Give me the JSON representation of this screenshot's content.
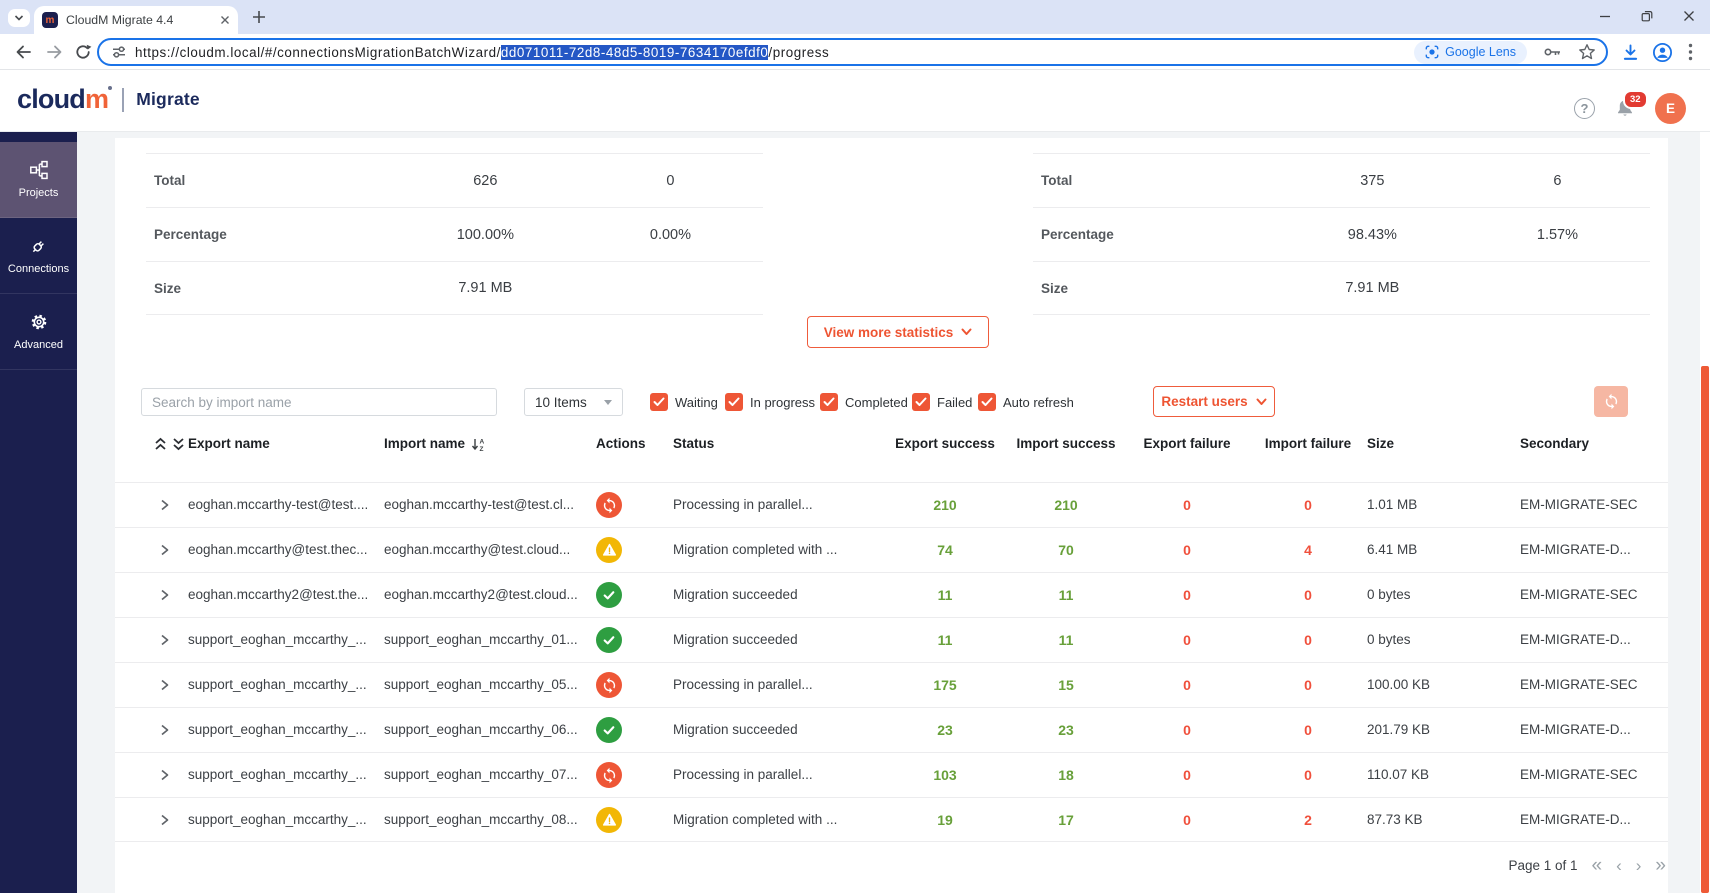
{
  "browser": {
    "tab_title": "CloudM Migrate 4.4",
    "favicon_letter": "m",
    "url_prefix": "https://cloudm.local/#/connectionsMigrationBatchWizard/",
    "url_selected": "dd071011-72d8-48d5-8019-7634170efdf0",
    "url_suffix": "/progress",
    "lens_label": "Google Lens"
  },
  "header": {
    "logo_cloud": "cloud",
    "logo_m": "m",
    "product": "Migrate",
    "help_glyph": "?",
    "notification_count": "32",
    "avatar_initial": "E"
  },
  "sidebar": {
    "items": [
      {
        "label": "Projects",
        "icon": "projects",
        "active": true
      },
      {
        "label": "Connections",
        "icon": "connections",
        "active": false
      },
      {
        "label": "Advanced",
        "icon": "advanced",
        "active": false
      }
    ]
  },
  "stats": {
    "export_table": {
      "rows": [
        {
          "label": "Total",
          "v1": "626",
          "v2": "0"
        },
        {
          "label": "Percentage",
          "v1": "100.00%",
          "v2": "0.00%"
        },
        {
          "label": "Size",
          "v1": "7.91 MB",
          "v2": ""
        }
      ]
    },
    "import_table": {
      "rows": [
        {
          "label": "Total",
          "v1": "375",
          "v2": "6"
        },
        {
          "label": "Percentage",
          "v1": "98.43%",
          "v2": "1.57%"
        },
        {
          "label": "Size",
          "v1": "7.91 MB",
          "v2": ""
        }
      ]
    },
    "view_more_label": "View more statistics"
  },
  "filters": {
    "search_placeholder": "Search by import name",
    "page_size_value": "10 Items",
    "checkboxes": [
      {
        "label": "Waiting",
        "checked": true
      },
      {
        "label": "In progress",
        "checked": true
      },
      {
        "label": "Completed",
        "checked": true
      },
      {
        "label": "Failed",
        "checked": true
      },
      {
        "label": "Auto refresh",
        "checked": true
      }
    ],
    "restart_label": "Restart users"
  },
  "table": {
    "columns": [
      "Export name",
      "Import name",
      "Actions",
      "Status",
      "Export success",
      "Import success",
      "Export failure",
      "Import failure",
      "Size",
      "Secondary"
    ],
    "rows": [
      {
        "export": "eoghan.mccarthy-test@test....",
        "import": "eoghan.mccarthy-test@test.cl...",
        "icon": "sync",
        "status": "Processing in parallel...",
        "exp_s": "210",
        "imp_s": "210",
        "exp_f": "0",
        "imp_f": "0",
        "size": "1.01 MB",
        "secondary": "EM-MIGRATE-SEC"
      },
      {
        "export": "eoghan.mccarthy@test.thec...",
        "import": "eoghan.mccarthy@test.cloud...",
        "icon": "warning",
        "status": "Migration completed with ...",
        "exp_s": "74",
        "imp_s": "70",
        "exp_f": "0",
        "imp_f": "4",
        "size": "6.41 MB",
        "secondary": "EM-MIGRATE-D..."
      },
      {
        "export": "eoghan.mccarthy2@test.the...",
        "import": "eoghan.mccarthy2@test.cloud...",
        "icon": "check",
        "status": "Migration succeeded",
        "exp_s": "11",
        "imp_s": "11",
        "exp_f": "0",
        "imp_f": "0",
        "size": "0 bytes",
        "secondary": "EM-MIGRATE-SEC"
      },
      {
        "export": "support_eoghan_mccarthy_...",
        "import": "support_eoghan_mccarthy_01...",
        "icon": "check",
        "status": "Migration succeeded",
        "exp_s": "11",
        "imp_s": "11",
        "exp_f": "0",
        "imp_f": "0",
        "size": "0 bytes",
        "secondary": "EM-MIGRATE-D..."
      },
      {
        "export": "support_eoghan_mccarthy_...",
        "import": "support_eoghan_mccarthy_05...",
        "icon": "sync",
        "status": "Processing in parallel...",
        "exp_s": "175",
        "imp_s": "15",
        "exp_f": "0",
        "imp_f": "0",
        "size": "100.00 KB",
        "secondary": "EM-MIGRATE-SEC"
      },
      {
        "export": "support_eoghan_mccarthy_...",
        "import": "support_eoghan_mccarthy_06...",
        "icon": "check",
        "status": "Migration succeeded",
        "exp_s": "23",
        "imp_s": "23",
        "exp_f": "0",
        "imp_f": "0",
        "size": "201.79 KB",
        "secondary": "EM-MIGRATE-D..."
      },
      {
        "export": "support_eoghan_mccarthy_...",
        "import": "support_eoghan_mccarthy_07...",
        "icon": "sync",
        "status": "Processing in parallel...",
        "exp_s": "103",
        "imp_s": "18",
        "exp_f": "0",
        "imp_f": "0",
        "size": "110.07 KB",
        "secondary": "EM-MIGRATE-SEC"
      },
      {
        "export": "support_eoghan_mccarthy_...",
        "import": "support_eoghan_mccarthy_08...",
        "icon": "warning",
        "status": "Migration completed with ...",
        "exp_s": "19",
        "imp_s": "17",
        "exp_f": "0",
        "imp_f": "2",
        "size": "87.73 KB",
        "secondary": "EM-MIGRATE-D..."
      }
    ]
  },
  "pagination": {
    "label": "Page 1 of 1"
  }
}
